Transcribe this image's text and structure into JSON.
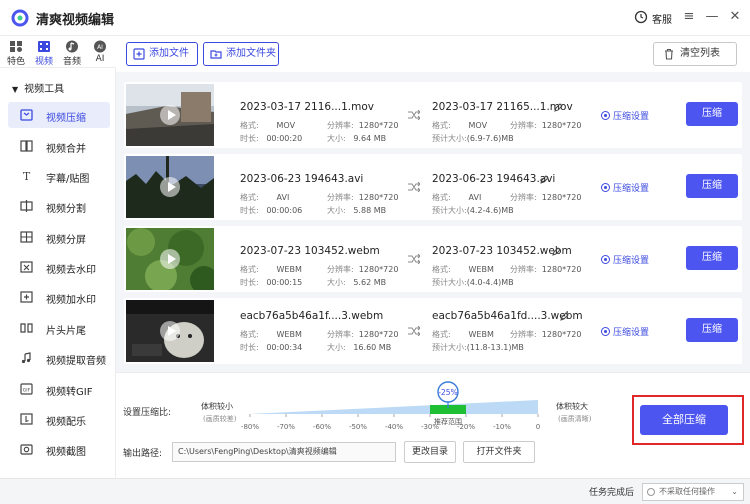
{
  "app": {
    "title": "清爽视频编辑",
    "service": "客服"
  },
  "categories": [
    {
      "label": "特色",
      "icon": "grid-icon"
    },
    {
      "label": "视频",
      "icon": "video-icon"
    },
    {
      "label": "音频",
      "icon": "audio-icon"
    },
    {
      "label": "AI",
      "icon": "ai-icon"
    }
  ],
  "sidebar": {
    "group": "视频工具",
    "items": [
      {
        "label": "视频压缩",
        "icon": "compress-icon"
      },
      {
        "label": "视频合并",
        "icon": "merge-icon"
      },
      {
        "label": "字幕/贴图",
        "icon": "subtitle-icon"
      },
      {
        "label": "视频分割",
        "icon": "split-icon"
      },
      {
        "label": "视频分屏",
        "icon": "splitscreen-icon"
      },
      {
        "label": "视频去水印",
        "icon": "remove-watermark-icon"
      },
      {
        "label": "视频加水印",
        "icon": "add-watermark-icon"
      },
      {
        "label": "片头片尾",
        "icon": "intro-outro-icon"
      },
      {
        "label": "视频提取音频",
        "icon": "extract-audio-icon"
      },
      {
        "label": "视频转GIF",
        "icon": "gif-icon"
      },
      {
        "label": "视频配乐",
        "icon": "music-icon"
      },
      {
        "label": "视频截图",
        "icon": "screenshot-icon"
      }
    ]
  },
  "toolbar": {
    "add_file": "添加文件",
    "add_folder": "添加文件夹",
    "clear_list": "清空列表"
  },
  "labels": {
    "format": "格式:",
    "duration": "时长:",
    "resolution": "分辨率:",
    "size": "大小:",
    "est_size": "预计大小:",
    "compress_settings": "压缩设置",
    "compress": "压缩"
  },
  "files": [
    {
      "src_name": "2023-03-17 2116...1.mov",
      "format": "MOV",
      "duration": "00:00:20",
      "resolution": "1280*720",
      "size": "9.64 MB",
      "out_name": "2023-03-17 21165...1.mov",
      "out_format": "MOV",
      "out_resolution": "1280*720",
      "est_size": "(6.9-7.6)MB"
    },
    {
      "src_name": "2023-06-23 194643.avi",
      "format": "AVI",
      "duration": "00:00:06",
      "resolution": "1280*720",
      "size": "5.88 MB",
      "out_name": "2023-06-23 194643.avi",
      "out_format": "AVI",
      "out_resolution": "1280*720",
      "est_size": "(4.2-4.6)MB"
    },
    {
      "src_name": "2023-07-23 103452.webm",
      "format": "WEBM",
      "duration": "00:00:15",
      "resolution": "1280*720",
      "size": "5.62 MB",
      "out_name": "2023-07-23 103452.webm",
      "out_format": "WEBM",
      "out_resolution": "1280*720",
      "est_size": "(4.0-4.4)MB"
    },
    {
      "src_name": "eacb76a5b46a1f....3.webm",
      "format": "WEBM",
      "duration": "00:00:34",
      "resolution": "1280*720",
      "size": "16.60 MB",
      "out_name": "eacb76a5b46a1fd....3.webm",
      "out_format": "WEBM",
      "out_resolution": "1280*720",
      "est_size": "(11.8-13.1)MB"
    }
  ],
  "compression": {
    "label": "设置压缩比:",
    "left_title": "体积较小",
    "left_sub": "(画质较差)",
    "right_title": "体积较大",
    "right_sub": "(画质清晰)",
    "current": "-25%",
    "current_value": -25,
    "recommended": "推荐范围",
    "recommended_range": [
      -30,
      -20
    ],
    "ticks": [
      "-80%",
      "-70%",
      "-60%",
      "-50%",
      "-40%",
      "-30%",
      "-20%",
      "-10%",
      "0"
    ]
  },
  "output": {
    "label": "输出路径:",
    "path": "C:\\Users\\FengPing\\Desktop\\清爽视频编辑",
    "change_dir": "更改目录",
    "open_folder": "打开文件夹"
  },
  "compress_all": "全部压缩",
  "status": {
    "label": "任务完成后",
    "option": "不采取任何操作"
  },
  "colors": {
    "accent": "#4c55f0",
    "highlight_frame": "#e02828",
    "slider_fill": "#bcd9f6",
    "recommended": "#1fbf34"
  }
}
